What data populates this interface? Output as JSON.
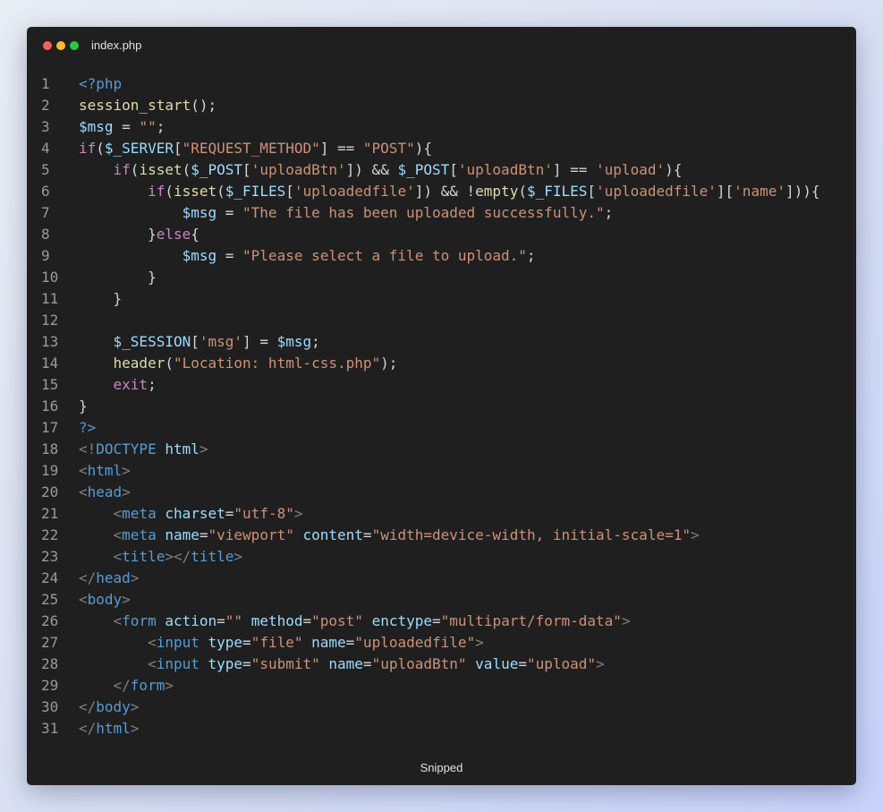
{
  "window": {
    "filename": "index.php",
    "footer": "Snipped"
  },
  "colors": {
    "background_start": "#e8ecf3",
    "background_end": "#c9d3fb",
    "editor_bg": "#1f1f1f",
    "close_dot": "#ff5f57",
    "minimize_dot": "#febc2e",
    "maximize_dot": "#28c840"
  },
  "code": {
    "lines": [
      {
        "n": "1",
        "tokens": [
          [
            "tag",
            "<?php"
          ]
        ]
      },
      {
        "n": "2",
        "tokens": [
          [
            "fn",
            "session_start"
          ],
          [
            "op",
            "();"
          ]
        ]
      },
      {
        "n": "3",
        "tokens": [
          [
            "var",
            "$msg"
          ],
          [
            "op",
            " = "
          ],
          [
            "str",
            "\"\""
          ],
          [
            "op",
            ";"
          ]
        ]
      },
      {
        "n": "4",
        "tokens": [
          [
            "kw",
            "if"
          ],
          [
            "op",
            "("
          ],
          [
            "var",
            "$_SERVER"
          ],
          [
            "op",
            "["
          ],
          [
            "str",
            "\"REQUEST_METHOD\""
          ],
          [
            "op",
            "] == "
          ],
          [
            "str",
            "\"POST\""
          ],
          [
            "op",
            "){"
          ]
        ]
      },
      {
        "n": "5",
        "tokens": [
          [
            "op",
            "    "
          ],
          [
            "kw",
            "if"
          ],
          [
            "op",
            "("
          ],
          [
            "fn",
            "isset"
          ],
          [
            "op",
            "("
          ],
          [
            "var",
            "$_POST"
          ],
          [
            "op",
            "["
          ],
          [
            "str",
            "'uploadBtn'"
          ],
          [
            "op",
            "]) && "
          ],
          [
            "var",
            "$_POST"
          ],
          [
            "op",
            "["
          ],
          [
            "str",
            "'uploadBtn'"
          ],
          [
            "op",
            "] == "
          ],
          [
            "str",
            "'upload'"
          ],
          [
            "op",
            "){"
          ]
        ]
      },
      {
        "n": "6",
        "tokens": [
          [
            "op",
            "        "
          ],
          [
            "kw",
            "if"
          ],
          [
            "op",
            "("
          ],
          [
            "fn",
            "isset"
          ],
          [
            "op",
            "("
          ],
          [
            "var",
            "$_FILES"
          ],
          [
            "op",
            "["
          ],
          [
            "str",
            "'uploadedfile'"
          ],
          [
            "op",
            "]) && !"
          ],
          [
            "fn",
            "empty"
          ],
          [
            "op",
            "("
          ],
          [
            "var",
            "$_FILES"
          ],
          [
            "op",
            "["
          ],
          [
            "str",
            "'uploadedfile'"
          ],
          [
            "op",
            "]["
          ],
          [
            "str",
            "'name'"
          ],
          [
            "op",
            "])){"
          ]
        ]
      },
      {
        "n": "7",
        "tokens": [
          [
            "op",
            "            "
          ],
          [
            "var",
            "$msg"
          ],
          [
            "op",
            " = "
          ],
          [
            "str",
            "\"The file has been uploaded successfully.\""
          ],
          [
            "op",
            ";"
          ]
        ]
      },
      {
        "n": "8",
        "tokens": [
          [
            "op",
            "        }"
          ],
          [
            "kw",
            "else"
          ],
          [
            "op",
            "{"
          ]
        ]
      },
      {
        "n": "9",
        "tokens": [
          [
            "op",
            "            "
          ],
          [
            "var",
            "$msg"
          ],
          [
            "op",
            " = "
          ],
          [
            "str",
            "\"Please select a file to upload.\""
          ],
          [
            "op",
            ";"
          ]
        ]
      },
      {
        "n": "10",
        "tokens": [
          [
            "op",
            "        }"
          ]
        ]
      },
      {
        "n": "11",
        "tokens": [
          [
            "op",
            "    }"
          ]
        ]
      },
      {
        "n": "12",
        "tokens": []
      },
      {
        "n": "13",
        "tokens": [
          [
            "op",
            "    "
          ],
          [
            "var",
            "$_SESSION"
          ],
          [
            "op",
            "["
          ],
          [
            "str",
            "'msg'"
          ],
          [
            "op",
            "] = "
          ],
          [
            "var",
            "$msg"
          ],
          [
            "op",
            ";"
          ]
        ]
      },
      {
        "n": "14",
        "tokens": [
          [
            "op",
            "    "
          ],
          [
            "fn",
            "header"
          ],
          [
            "op",
            "("
          ],
          [
            "str",
            "\"Location: html-css.php\""
          ],
          [
            "op",
            ");"
          ]
        ]
      },
      {
        "n": "15",
        "tokens": [
          [
            "op",
            "    "
          ],
          [
            "kw",
            "exit"
          ],
          [
            "op",
            ";"
          ]
        ]
      },
      {
        "n": "16",
        "tokens": [
          [
            "op",
            "}"
          ]
        ]
      },
      {
        "n": "17",
        "tokens": [
          [
            "tag",
            "?>"
          ]
        ]
      },
      {
        "n": "18",
        "tokens": [
          [
            "pn",
            "<!"
          ],
          [
            "tag",
            "DOCTYPE"
          ],
          [
            "op",
            " "
          ],
          [
            "attr",
            "html"
          ],
          [
            "pn",
            ">"
          ]
        ]
      },
      {
        "n": "19",
        "tokens": [
          [
            "pn",
            "<"
          ],
          [
            "tag",
            "html"
          ],
          [
            "pn",
            ">"
          ]
        ]
      },
      {
        "n": "20",
        "tokens": [
          [
            "pn",
            "<"
          ],
          [
            "tag",
            "head"
          ],
          [
            "pn",
            ">"
          ]
        ]
      },
      {
        "n": "21",
        "tokens": [
          [
            "op",
            "    "
          ],
          [
            "pn",
            "<"
          ],
          [
            "tag",
            "meta"
          ],
          [
            "op",
            " "
          ],
          [
            "attr",
            "charset"
          ],
          [
            "op",
            "="
          ],
          [
            "str",
            "\"utf-8\""
          ],
          [
            "pn",
            ">"
          ]
        ]
      },
      {
        "n": "22",
        "tokens": [
          [
            "op",
            "    "
          ],
          [
            "pn",
            "<"
          ],
          [
            "tag",
            "meta"
          ],
          [
            "op",
            " "
          ],
          [
            "attr",
            "name"
          ],
          [
            "op",
            "="
          ],
          [
            "str",
            "\"viewport\""
          ],
          [
            "op",
            " "
          ],
          [
            "attr",
            "content"
          ],
          [
            "op",
            "="
          ],
          [
            "str",
            "\"width=device-width, initial-scale=1\""
          ],
          [
            "pn",
            ">"
          ]
        ]
      },
      {
        "n": "23",
        "tokens": [
          [
            "op",
            "    "
          ],
          [
            "pn",
            "<"
          ],
          [
            "tag",
            "title"
          ],
          [
            "pn",
            "></"
          ],
          [
            "tag",
            "title"
          ],
          [
            "pn",
            ">"
          ]
        ]
      },
      {
        "n": "24",
        "tokens": [
          [
            "pn",
            "</"
          ],
          [
            "tag",
            "head"
          ],
          [
            "pn",
            ">"
          ]
        ]
      },
      {
        "n": "25",
        "tokens": [
          [
            "pn",
            "<"
          ],
          [
            "tag",
            "body"
          ],
          [
            "pn",
            ">"
          ]
        ]
      },
      {
        "n": "26",
        "tokens": [
          [
            "op",
            "    "
          ],
          [
            "pn",
            "<"
          ],
          [
            "tag",
            "form"
          ],
          [
            "op",
            " "
          ],
          [
            "attr",
            "action"
          ],
          [
            "op",
            "="
          ],
          [
            "str",
            "\"\""
          ],
          [
            "op",
            " "
          ],
          [
            "attr",
            "method"
          ],
          [
            "op",
            "="
          ],
          [
            "str",
            "\"post\""
          ],
          [
            "op",
            " "
          ],
          [
            "attr",
            "enctype"
          ],
          [
            "op",
            "="
          ],
          [
            "str",
            "\"multipart/form-data\""
          ],
          [
            "pn",
            ">"
          ]
        ]
      },
      {
        "n": "27",
        "tokens": [
          [
            "op",
            "        "
          ],
          [
            "pn",
            "<"
          ],
          [
            "tag",
            "input"
          ],
          [
            "op",
            " "
          ],
          [
            "attr",
            "type"
          ],
          [
            "op",
            "="
          ],
          [
            "str",
            "\"file\""
          ],
          [
            "op",
            " "
          ],
          [
            "attr",
            "name"
          ],
          [
            "op",
            "="
          ],
          [
            "str",
            "\"uploadedfile\""
          ],
          [
            "pn",
            ">"
          ]
        ]
      },
      {
        "n": "28",
        "tokens": [
          [
            "op",
            "        "
          ],
          [
            "pn",
            "<"
          ],
          [
            "tag",
            "input"
          ],
          [
            "op",
            " "
          ],
          [
            "attr",
            "type"
          ],
          [
            "op",
            "="
          ],
          [
            "str",
            "\"submit\""
          ],
          [
            "op",
            " "
          ],
          [
            "attr",
            "name"
          ],
          [
            "op",
            "="
          ],
          [
            "str",
            "\"uploadBtn\""
          ],
          [
            "op",
            " "
          ],
          [
            "attr",
            "value"
          ],
          [
            "op",
            "="
          ],
          [
            "str",
            "\"upload\""
          ],
          [
            "pn",
            ">"
          ]
        ]
      },
      {
        "n": "29",
        "tokens": [
          [
            "op",
            "    "
          ],
          [
            "pn",
            "</"
          ],
          [
            "tag",
            "form"
          ],
          [
            "pn",
            ">"
          ]
        ]
      },
      {
        "n": "30",
        "tokens": [
          [
            "pn",
            "</"
          ],
          [
            "tag",
            "body"
          ],
          [
            "pn",
            ">"
          ]
        ]
      },
      {
        "n": "31",
        "tokens": [
          [
            "pn",
            "</"
          ],
          [
            "tag",
            "html"
          ],
          [
            "pn",
            ">"
          ]
        ]
      }
    ]
  }
}
